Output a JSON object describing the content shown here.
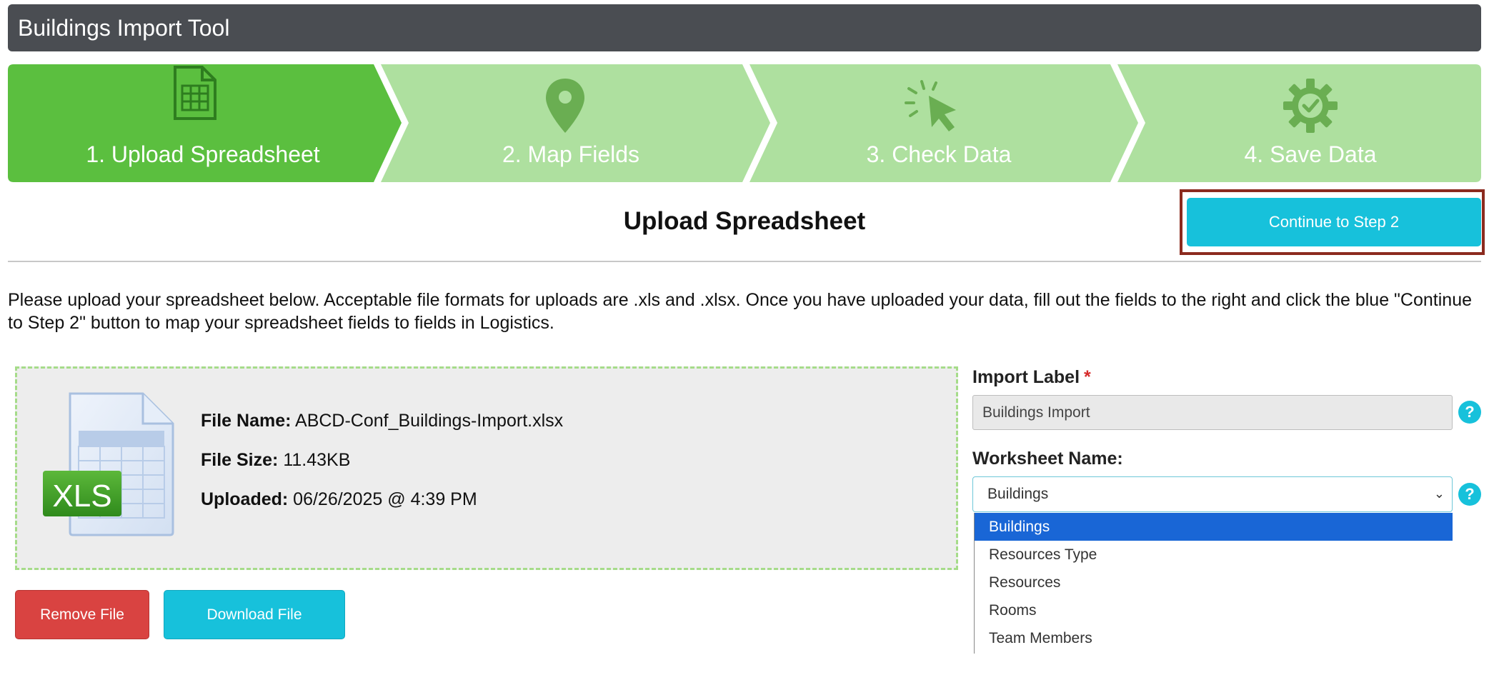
{
  "header": {
    "title": "Buildings Import Tool"
  },
  "steps": [
    {
      "label": "1. Upload Spreadsheet",
      "icon": "spreadsheet-icon",
      "active": true
    },
    {
      "label": "2. Map Fields",
      "icon": "map-pin-icon",
      "active": false
    },
    {
      "label": "3. Check Data",
      "icon": "cursor-click-icon",
      "active": false
    },
    {
      "label": "4. Save Data",
      "icon": "gear-check-icon",
      "active": false
    }
  ],
  "colors": {
    "active_step": "#5bbf3f",
    "inactive_step": "#aee09f",
    "accent": "#17c1db",
    "danger": "#d94341",
    "highlight_frame": "#8b2a1e"
  },
  "section": {
    "title": "Upload Spreadsheet",
    "continue_label": "Continue to Step 2"
  },
  "intro_text": "Please upload your spreadsheet below. Acceptable file formats for uploads are .xls and .xlsx. Once you have uploaded your data, fill out the fields to the right and click the blue \"Continue to Step 2\" button to map your spreadsheet fields to fields in Logistics.",
  "file": {
    "icon_text": "XLS",
    "name_label": "File Name:",
    "name_value": "ABCD-Conf_Buildings-Import.xlsx",
    "size_label": "File Size:",
    "size_value": "11.43KB",
    "uploaded_label": "Uploaded:",
    "uploaded_value": "06/26/2025 @ 4:39 PM"
  },
  "buttons": {
    "remove": "Remove File",
    "download": "Download File"
  },
  "form": {
    "import_label": {
      "label": "Import Label",
      "required_mark": "*",
      "value": "Buildings Import"
    },
    "worksheet": {
      "label": "Worksheet Name:",
      "selected": "Buildings",
      "options": [
        "Buildings",
        "Resources Type",
        "Resources",
        "Rooms",
        "Team Members"
      ]
    },
    "help_glyph": "?"
  }
}
